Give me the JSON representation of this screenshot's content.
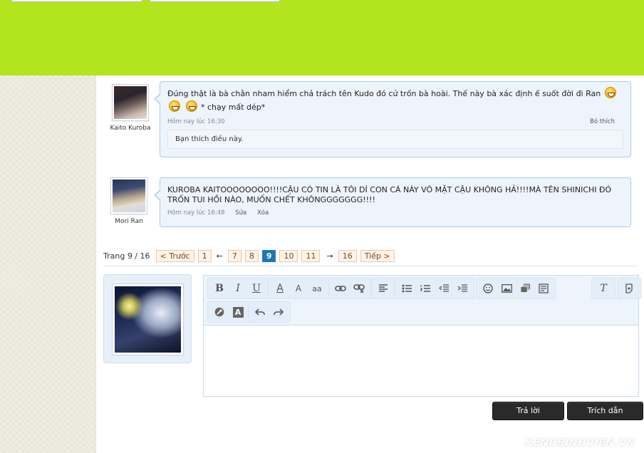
{
  "header": {},
  "posts": [
    {
      "username": "Kaito Kuroba",
      "avatar_icon": "avatar-kaito",
      "message_part1": "Đúng thật là bà chằn nham hiểm chả trách tên Kudo đó cứ trốn bà hoài. Thế này bà xác định ế suốt đời đi Ran",
      "message_part2": "* chạy mất dép*",
      "smiley_icon": "laughing-smiley-icon",
      "time": "Hôm nay lúc 16:30",
      "like_label": "Bỏ thích",
      "likes_text": "Bạn thích điều này."
    },
    {
      "username": "Mori Ran",
      "avatar_icon": "avatar-ran",
      "message": "KUROBA KAITOOOOOOOO!!!!CẬU CÓ TIN LÀ TÔI DÍ CON CÁ NÀY VÔ MẶT CẬU KHÔNG HẢ!!!!MÀ TÊN SHINICHI ĐÓ TRỐN TUI HỒI NÀO, MUỐN CHẾT KHÔNGGGGGGG!!!!",
      "time": "Hôm nay lúc 16:48",
      "edit_label": "Sửa",
      "delete_label": "Xóa"
    }
  ],
  "pagination": {
    "label": "Trang 9 / 16",
    "prev": "< Trước",
    "first": "1",
    "left_arrow": "←",
    "pages": [
      "7",
      "8",
      "9",
      "10",
      "11"
    ],
    "current": "9",
    "right_arrow": "→",
    "last": "16",
    "next": "Tiếp >"
  },
  "editor": {
    "toolbar_icons": [
      "bold-icon",
      "italic-icon",
      "underline-icon",
      "text-color-icon",
      "font-size-icon",
      "font-family-icon",
      "link-icon",
      "unlink-icon",
      "align-icon",
      "bullet-list-icon",
      "numbered-list-icon",
      "outdent-icon",
      "indent-icon",
      "smilie-icon",
      "image-icon",
      "media-icon",
      "insert-more-icon",
      "remove-format-icon",
      "toggle-bbcode-icon",
      "wrench-icon",
      "font-icon",
      "undo-icon",
      "redo-icon"
    ],
    "glyphs": {
      "bold": "B",
      "italic": "I",
      "underline": "U",
      "text_color": "A",
      "font_size": "A",
      "font_family": "aa",
      "remove_format": "T",
      "font": "A"
    }
  },
  "buttons": {
    "reply": "Trả lời",
    "quote": "Trích dẫn"
  },
  "watermark": "KENHSINHVIEN.VN",
  "colors": {
    "header": "#b3e51f",
    "bubble_bg": "#edf4fc",
    "bubble_border": "#a9cce6",
    "current_page": "#1b78b8",
    "button_bg": "#2a2a2a"
  }
}
